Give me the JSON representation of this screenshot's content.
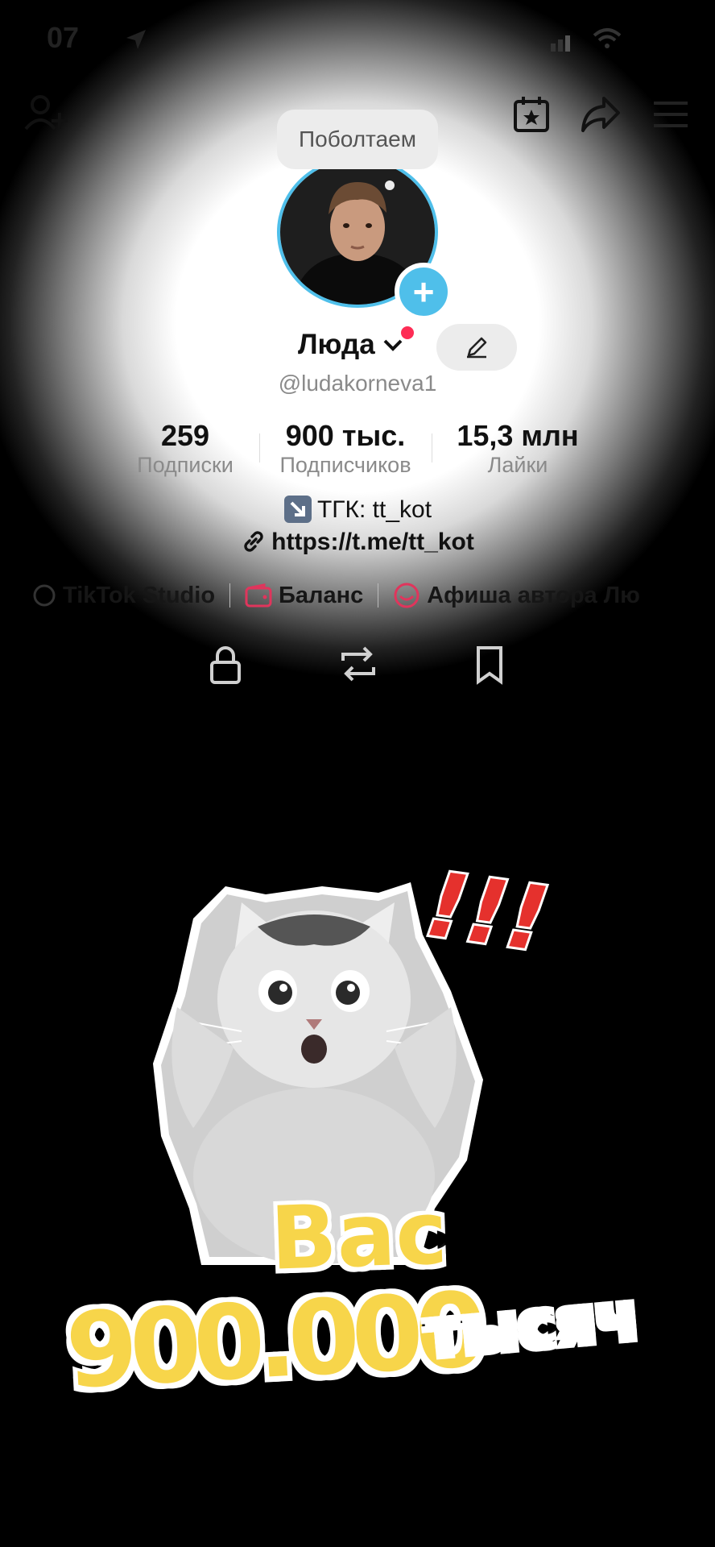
{
  "status_bar": {
    "time": "07"
  },
  "profile": {
    "note_bubble": "Поболтаем",
    "name": "Люда",
    "handle": "@ludakorneva1",
    "stats": [
      {
        "value": "259",
        "label": "Подписки"
      },
      {
        "value": "900 тыс.",
        "label": "Подписчиков"
      },
      {
        "value": "15,3 млн",
        "label": "Лайки"
      }
    ],
    "bio_line1": "ТГК: tt_kot",
    "bio_link": "https://t.me/tt_kot",
    "tools": [
      {
        "label": "TikTok Studio",
        "icon": "tiktok-studio-icon"
      },
      {
        "label": "Баланс",
        "icon": "wallet-icon"
      },
      {
        "label": "Афиша автора Лю",
        "icon": "event-icon"
      }
    ]
  },
  "caption": {
    "line1": "Вас",
    "line2_number": "900.000",
    "line2_word": "тысяч",
    "exclamation": "!!!"
  },
  "colors": {
    "accent_blue": "#4fbfea",
    "notification_red": "#fe2c55",
    "caption_yellow": "#f7d54a"
  }
}
